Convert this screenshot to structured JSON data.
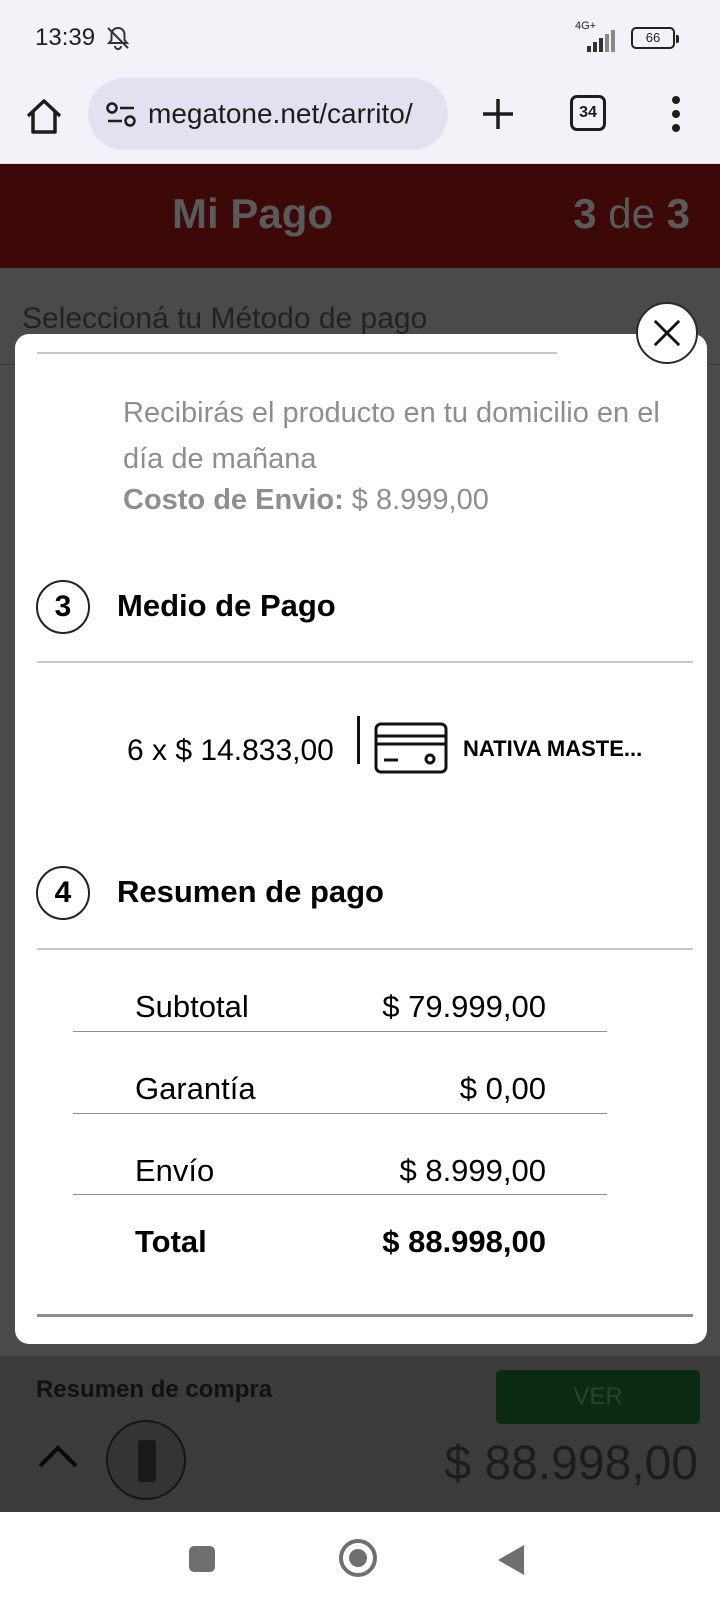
{
  "status_bar": {
    "time": "13:39",
    "network": "4G+",
    "battery": "66"
  },
  "browser": {
    "url": "megatone.net/carrito/",
    "tab_count": "34"
  },
  "page": {
    "title": "Mi Pago",
    "step_current": "3",
    "step_word": "de",
    "step_total": "3",
    "subtitle": "Seleccioná tu Método de pago"
  },
  "modal": {
    "delivery_text": "Recibirás el producto en tu domicilio en el día de mañana",
    "shipping_cost_label": "Costo de Envio:",
    "shipping_cost_value": "$ 8.999,00",
    "payment_section": {
      "number": "3",
      "title": "Medio de Pago",
      "installments": "6 x $ 14.833,00",
      "card_name": "NATIVA MASTE..."
    },
    "summary_section": {
      "number": "4",
      "title": "Resumen de pago",
      "rows": [
        {
          "label": "Subtotal",
          "value": "$ 79.999,00"
        },
        {
          "label": "Garantía",
          "value": "$ 0,00"
        },
        {
          "label": "Envío",
          "value": "$ 8.999,00"
        }
      ],
      "total_label": "Total",
      "total_value": "$ 88.998,00"
    }
  },
  "purchase_bar": {
    "title": "Resumen de compra",
    "button_label": "VER",
    "total": "$ 88.998,00"
  }
}
